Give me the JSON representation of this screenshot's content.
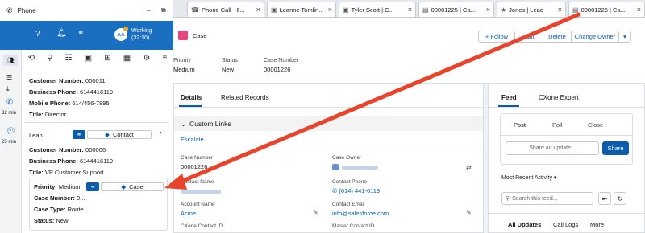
{
  "phone_title": "Phone",
  "status": {
    "label": "Working",
    "time": "(32:10)",
    "initials": "AA"
  },
  "sidebar": {
    "call_time": "32 min",
    "chat_time": "25 min"
  },
  "contact1": {
    "customer_number_label": "Customer Number:",
    "customer_number": "000011",
    "business_phone_label": "Business Phone:",
    "business_phone": "6144416119",
    "mobile_phone_label": "Mobile Phone:",
    "mobile_phone": "614/456-7895",
    "title_label": "Title:",
    "title": "Director"
  },
  "contact2": {
    "name": "Lean...",
    "type": "Contact",
    "customer_number_label": "Customer Number:",
    "customer_number": "000006",
    "business_phone_label": "Business Phone:",
    "business_phone": "6144416119",
    "title_label": "Title:",
    "title": "VP Customer Support"
  },
  "case_card": {
    "priority_label": "Priority:",
    "priority": "Medium",
    "type": "Case",
    "case_number_label": "Case Number:",
    "case_number": "0...",
    "case_type_label": "Case Type:",
    "case_type": "Route...",
    "status_label": "Status:",
    "status": "New"
  },
  "tabs": [
    {
      "label": "Phone Call - 6..."
    },
    {
      "label": "Leanne Tomlin..."
    },
    {
      "label": "Tyler Scott | C..."
    },
    {
      "label": "00001225 | Ca..."
    },
    {
      "label": "Jones | Lead"
    },
    {
      "label": "00001226 | Ca..."
    }
  ],
  "header": {
    "object": "Case",
    "follow": "+ Follow",
    "edit": "Edit",
    "delete": "Delete",
    "change_owner": "Change Owner",
    "priority_label": "Priority",
    "priority": "Medium",
    "status_label": "Status",
    "status": "New",
    "case_number_label": "Case Number",
    "case_number": "00001226"
  },
  "detail": {
    "tab_details": "Details",
    "tab_related": "Related Records",
    "section": "Custom Links",
    "escalate": "Escalate",
    "case_number_label": "Case Number",
    "case_number": "00001226",
    "case_owner_label": "Case Owner",
    "contact_name_label": "Contact Name",
    "contact_phone_label": "Contact Phone",
    "contact_phone": "(614) 441-6119",
    "account_name_label": "Account Name",
    "account_name": "Acme",
    "contact_email_label": "Contact Email",
    "contact_email": "info@salesforce.com",
    "cxone_label": "CXone Contact ID",
    "master_label": "Master Contact ID"
  },
  "feed": {
    "tab_feed": "Feed",
    "tab_expert": "CXone Expert",
    "post": "Post",
    "poll": "Poll",
    "close": "Close",
    "share_placeholder": "Share an update...",
    "share_button": "Share",
    "sort": "Most Recent Activity",
    "search_placeholder": "Search this feed...",
    "all_updates": "All Updates",
    "call_logs": "Call Logs",
    "more": "More"
  },
  "colors": {
    "brand_blue": "#1b6fc0",
    "link": "#0b5cab",
    "case_pink": "#e9457b",
    "arrow_red": "#e8442c"
  }
}
